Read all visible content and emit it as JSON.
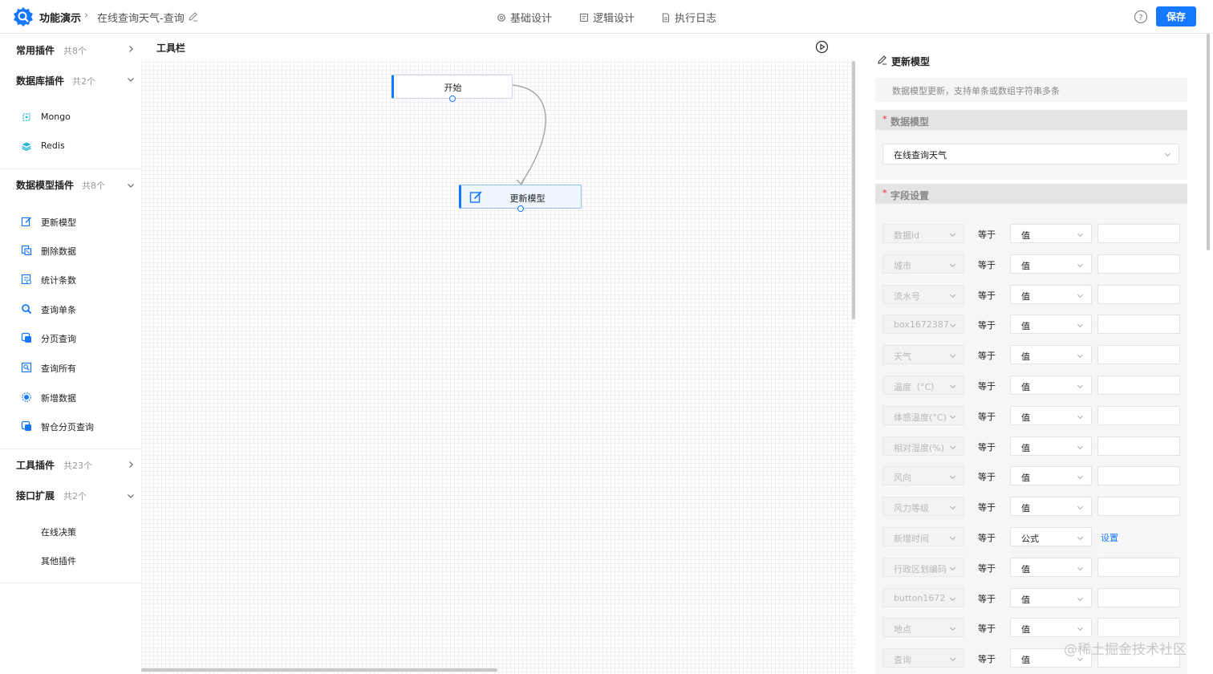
{
  "header": {
    "app_name": "功能演示",
    "page_title": "在线查询天气-查询",
    "tabs": [
      {
        "label": "基础设计",
        "icon": "gear-icon"
      },
      {
        "label": "逻辑设计",
        "icon": "logic-icon"
      },
      {
        "label": "执行日志",
        "icon": "document-icon"
      }
    ],
    "save_label": "保存"
  },
  "sidebar": {
    "groups": [
      {
        "title": "常用插件",
        "count": "共8个",
        "expanded": false
      },
      {
        "title": "数据库插件",
        "count": "共2个",
        "expanded": true
      },
      {
        "title": "数据模型插件",
        "count": "共8个",
        "expanded": true
      },
      {
        "title": "工具插件",
        "count": "共23个",
        "expanded": false
      },
      {
        "title": "接口扩展",
        "count": "共2个",
        "expanded": true
      }
    ],
    "db_items": [
      {
        "label": "Mongo",
        "icon": "mongo-icon"
      },
      {
        "label": "Redis",
        "icon": "redis-icon"
      }
    ],
    "model_items": [
      {
        "label": "更新模型",
        "icon": "edit-model-icon"
      },
      {
        "label": "删除数据",
        "icon": "delete-data-icon"
      },
      {
        "label": "统计条数",
        "icon": "count-icon"
      },
      {
        "label": "查询单条",
        "icon": "search-icon"
      },
      {
        "label": "分页查询",
        "icon": "page-query-icon"
      },
      {
        "label": "查询所有",
        "icon": "query-all-icon"
      },
      {
        "label": "新增数据",
        "icon": "add-data-icon"
      },
      {
        "label": "智仓分页查询",
        "icon": "page-query-icon"
      }
    ],
    "api_items": [
      {
        "label": "在线决策"
      },
      {
        "label": "其他插件"
      }
    ]
  },
  "canvas": {
    "toolbar_label": "工具栏",
    "nodes": {
      "start": "开始",
      "update": "更新模型"
    }
  },
  "panel": {
    "title": "更新模型",
    "description": "数据模型更新，支持单条或数组字符串多条",
    "model_section": {
      "title": "数据模型",
      "selected": "在线查询天气"
    },
    "fields_section": {
      "title": "字段设置",
      "operator": "等于",
      "rows": [
        {
          "field": "数据id",
          "mode": "值",
          "action": ""
        },
        {
          "field": "城市",
          "mode": "值",
          "action": ""
        },
        {
          "field": "流水号",
          "mode": "值",
          "action": ""
        },
        {
          "field": "box1672387",
          "mode": "值",
          "action": ""
        },
        {
          "field": "天气",
          "mode": "值",
          "action": ""
        },
        {
          "field": "温度（°C）",
          "mode": "值",
          "action": ""
        },
        {
          "field": "体感温度(°C)",
          "mode": "值",
          "action": ""
        },
        {
          "field": "相对湿度(%)",
          "mode": "值",
          "action": ""
        },
        {
          "field": "风向",
          "mode": "值",
          "action": ""
        },
        {
          "field": "风力等级",
          "mode": "值",
          "action": ""
        },
        {
          "field": "新增时间",
          "mode": "公式",
          "action": "设置"
        },
        {
          "field": "行政区划编码",
          "mode": "值",
          "action": ""
        },
        {
          "field": "button1672",
          "mode": "值",
          "action": ""
        },
        {
          "field": "地点",
          "mode": "值",
          "action": ""
        },
        {
          "field": "查询",
          "mode": "值",
          "action": ""
        }
      ]
    }
  },
  "watermark": "@稀土掘金技术社区",
  "colors": {
    "accent": "#1677ff",
    "required": "#f5222d"
  }
}
